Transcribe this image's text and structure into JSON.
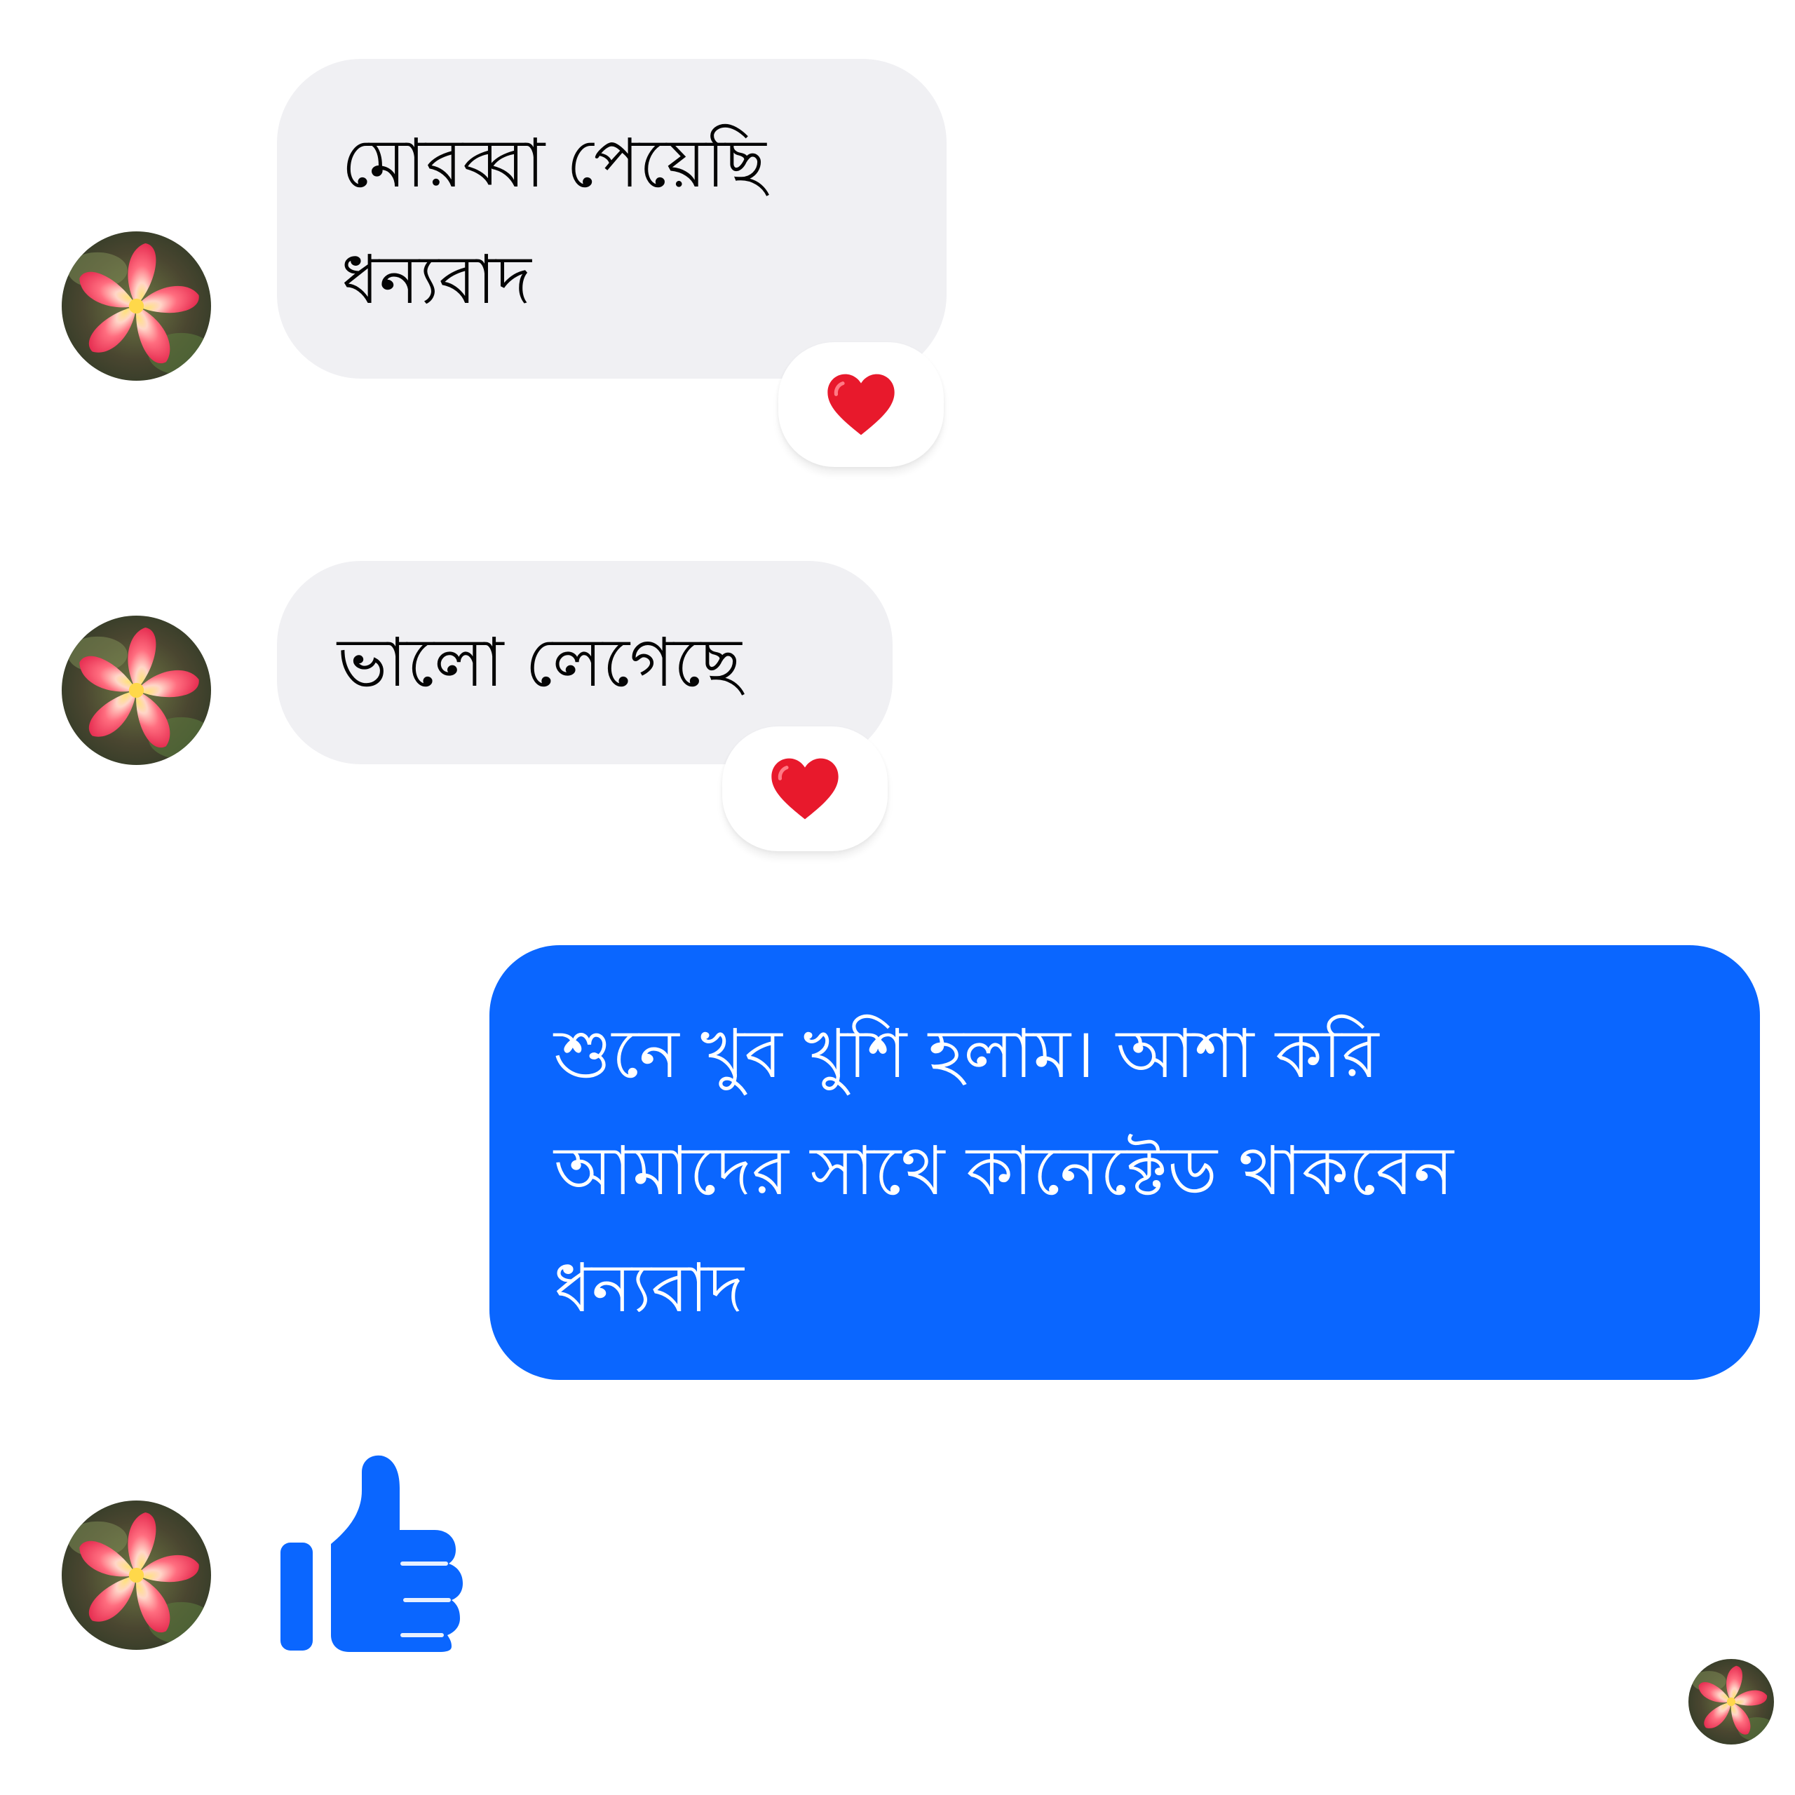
{
  "conversation": {
    "messages": [
      {
        "direction": "incoming",
        "text": "মোরব্বা পেয়েছি\nধন্যবাদ",
        "reaction": "heart"
      },
      {
        "direction": "incoming",
        "text": "ভালো লেগেছে",
        "reaction": "heart"
      },
      {
        "direction": "outgoing",
        "text": "শুনে খুব খুশি হলাম। আশা করি\nআমাদের সাথে কানেক্টেড থাকবেন\nধন্যবাদ"
      },
      {
        "direction": "incoming",
        "type": "like-sticker",
        "icon": "thumbs-up-icon"
      }
    ],
    "seen_indicator": "avatar"
  },
  "colors": {
    "incoming_bubble": "#f0f0f3",
    "outgoing_bubble": "#0a66ff",
    "like_icon": "#0a66ff",
    "heart": "#e8192c"
  }
}
